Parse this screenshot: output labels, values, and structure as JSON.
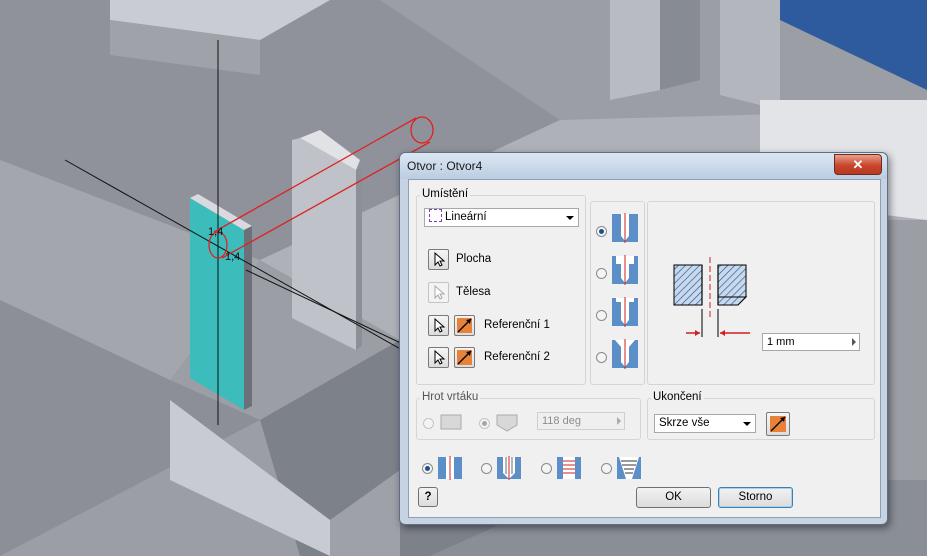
{
  "sketch": {
    "dim_label_1": "1,4",
    "dim_label_2": "1,4"
  },
  "dialog": {
    "title": "Otvor : Otvor4",
    "close_glyph": "✕",
    "placement": {
      "group_label": "Umístění",
      "type_value": "Lineární",
      "items": [
        {
          "label": "Plocha"
        },
        {
          "label": "Tělesa"
        },
        {
          "label": "Referenční 1"
        },
        {
          "label": "Referenční 2"
        }
      ]
    },
    "hole_types": [
      {
        "name": "drilled",
        "selected": true
      },
      {
        "name": "counterbore",
        "selected": false
      },
      {
        "name": "spotface",
        "selected": false
      },
      {
        "name": "countersink",
        "selected": false
      }
    ],
    "preview": {
      "diameter_value": "1 mm"
    },
    "drill_point": {
      "group_label": "Hrot vrtáku",
      "options": [
        {
          "name": "flat",
          "selected": false
        },
        {
          "name": "angle",
          "selected": true
        }
      ],
      "angle_value": "118 deg"
    },
    "termination": {
      "group_label": "Ukončení",
      "value": "Skrze vše"
    },
    "thread_types": [
      {
        "name": "simple",
        "selected": true
      },
      {
        "name": "clearance",
        "selected": false
      },
      {
        "name": "tapped",
        "selected": false
      },
      {
        "name": "taper-tapped",
        "selected": false
      }
    ],
    "buttons": {
      "help_glyph": "?",
      "ok": "OK",
      "cancel": "Storno"
    }
  },
  "colors": {
    "face_highlight": "#3dbcbc",
    "sketch_red": "#e02020",
    "accent_blue": "#1d4f91"
  }
}
